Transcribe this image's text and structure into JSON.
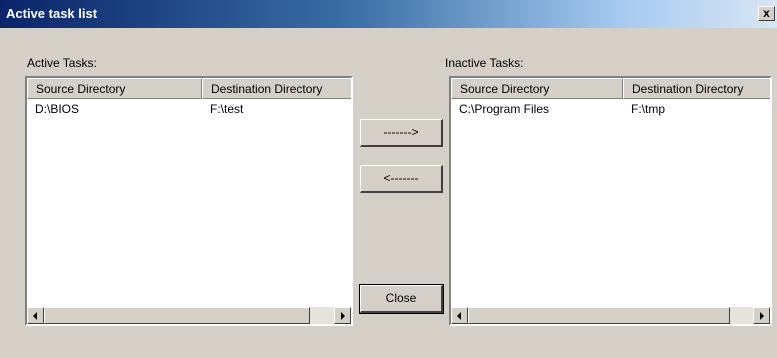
{
  "window": {
    "title": "Active task list",
    "close_glyph": "x"
  },
  "active": {
    "label": "Active Tasks:",
    "columns": [
      "Source Directory",
      "Destination Directory"
    ],
    "rows": [
      {
        "source": "D:\\BIOS",
        "destination": "F:\\test"
      }
    ]
  },
  "inactive": {
    "label": "Inactive Tasks:",
    "columns": [
      "Source Directory",
      "Destination Directory"
    ],
    "rows": [
      {
        "source": "C:\\Program Files",
        "destination": "F:\\tmp"
      }
    ]
  },
  "buttons": {
    "move_right": "------->",
    "move_left": "<-------",
    "close": "Close"
  }
}
